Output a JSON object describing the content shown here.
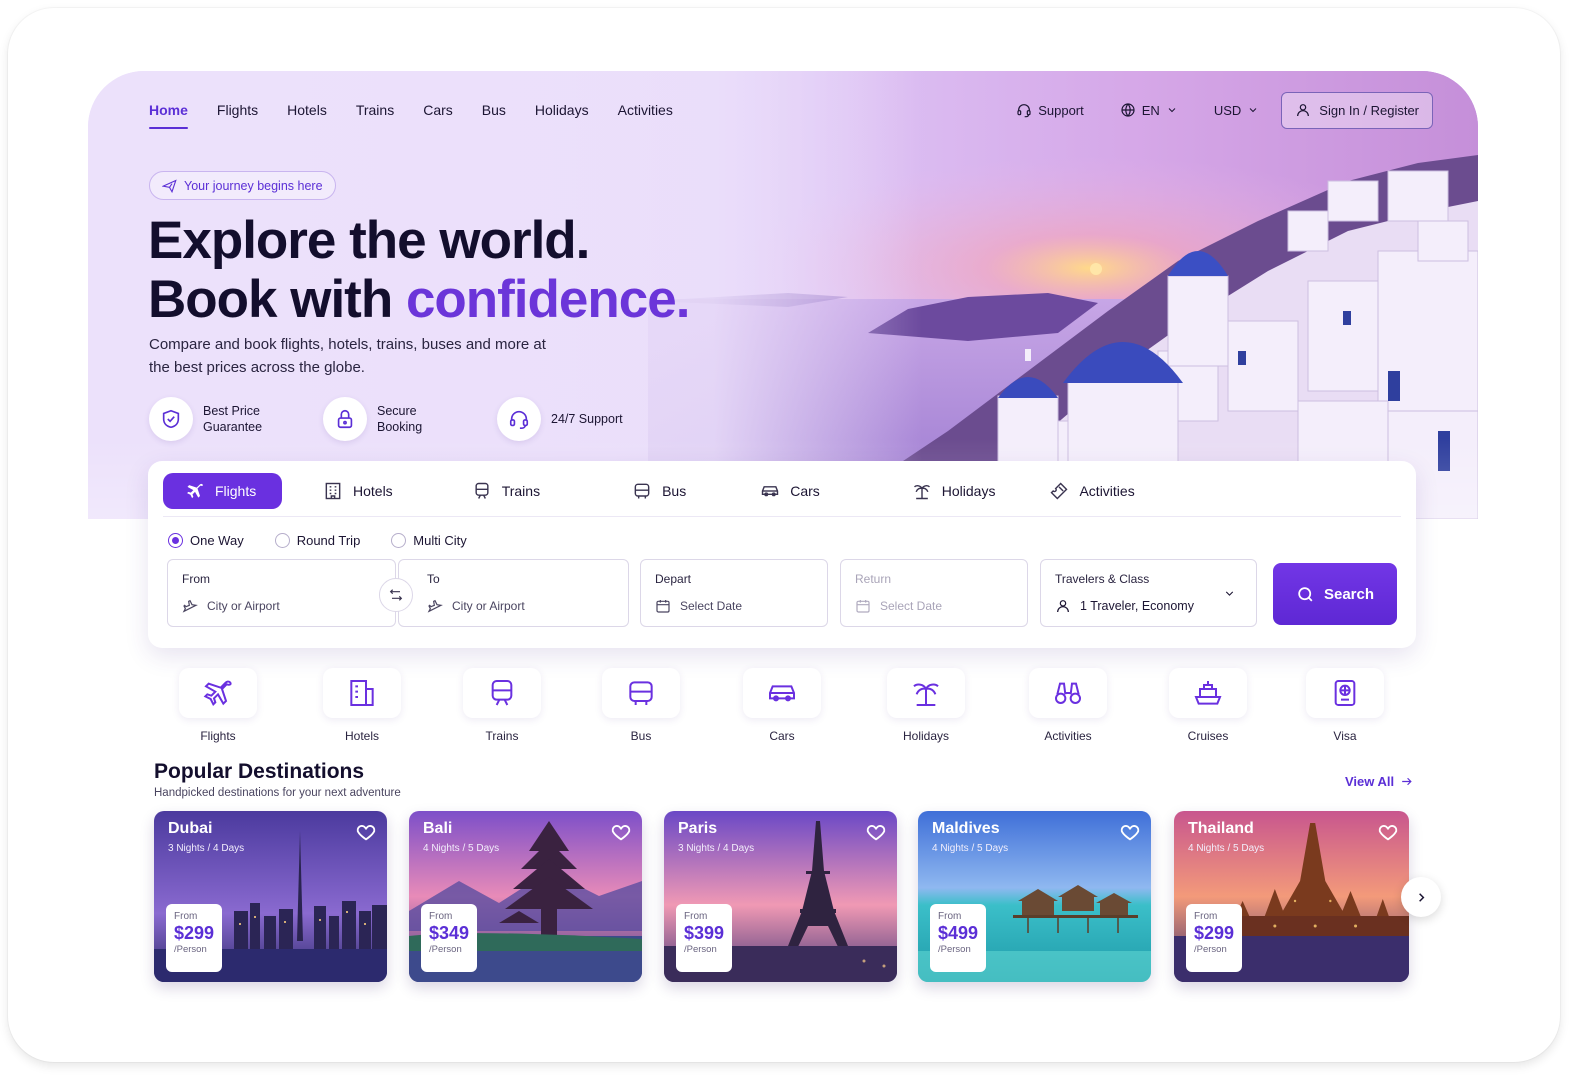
{
  "nav": {
    "links": [
      "Home",
      "Flights",
      "Hotels",
      "Trains",
      "Cars",
      "Bus",
      "Holidays",
      "Activities"
    ],
    "active": "Home",
    "support": "Support",
    "language": "EN",
    "currency": "USD",
    "signin": "Sign In / Register"
  },
  "hero": {
    "badge": "Your journey begins here",
    "title_line1": "Explore the world.",
    "title_line2_prefix": "Book with ",
    "title_line2_accent": "confidence.",
    "subtitle": "Compare and book flights, hotels, trains, buses and more at the best prices across the globe.",
    "features": [
      {
        "icon": "shield-check-icon",
        "label": "Best Price Guarantee"
      },
      {
        "icon": "lock-icon",
        "label": "Secure Booking"
      },
      {
        "icon": "headset-icon",
        "label": "24/7 Support"
      }
    ]
  },
  "search": {
    "tabs": [
      {
        "label": "Flights",
        "icon": "plane-icon"
      },
      {
        "label": "Hotels",
        "icon": "building-icon"
      },
      {
        "label": "Trains",
        "icon": "train-icon"
      },
      {
        "label": "Bus",
        "icon": "bus-icon"
      },
      {
        "label": "Cars",
        "icon": "car-icon"
      },
      {
        "label": "Holidays",
        "icon": "palm-icon"
      },
      {
        "label": "Activities",
        "icon": "ticket-icon"
      }
    ],
    "trip_types": [
      "One Way",
      "Round Trip",
      "Multi City"
    ],
    "selected_trip": "One Way",
    "from": {
      "label": "From",
      "placeholder": "City or Airport"
    },
    "to": {
      "label": "To",
      "placeholder": "City or Airport"
    },
    "depart": {
      "label": "Depart",
      "placeholder": "Select Date"
    },
    "return": {
      "label": "Return",
      "placeholder": "Select Date"
    },
    "travelers": {
      "label": "Travelers & Class",
      "value": "1 Traveler, Economy"
    },
    "button": "Search"
  },
  "categories": [
    "Flights",
    "Hotels",
    "Trains",
    "Bus",
    "Cars",
    "Holidays",
    "Activities",
    "Cruises",
    "Visa"
  ],
  "popular": {
    "title": "Popular Destinations",
    "subtitle": "Handpicked destinations for your next adventure",
    "view_all": "View All",
    "cards": [
      {
        "name": "Dubai",
        "duration": "3 Nights / 4 Days",
        "from": "From",
        "price": "$299",
        "per": "/Person"
      },
      {
        "name": "Bali",
        "duration": "4 Nights / 5 Days",
        "from": "From",
        "price": "$349",
        "per": "/Person"
      },
      {
        "name": "Paris",
        "duration": "3 Nights / 4 Days",
        "from": "From",
        "price": "$399",
        "per": "/Person"
      },
      {
        "name": "Maldives",
        "duration": "4 Nights / 5 Days",
        "from": "From",
        "price": "$499",
        "per": "/Person"
      },
      {
        "name": "Thailand",
        "duration": "4 Nights / 5 Days",
        "from": "From",
        "price": "$299",
        "per": "/Person"
      }
    ]
  },
  "colors": {
    "accent": "#6a30e0",
    "accent_text": "#5b2fd6",
    "ink": "#130e2d"
  }
}
